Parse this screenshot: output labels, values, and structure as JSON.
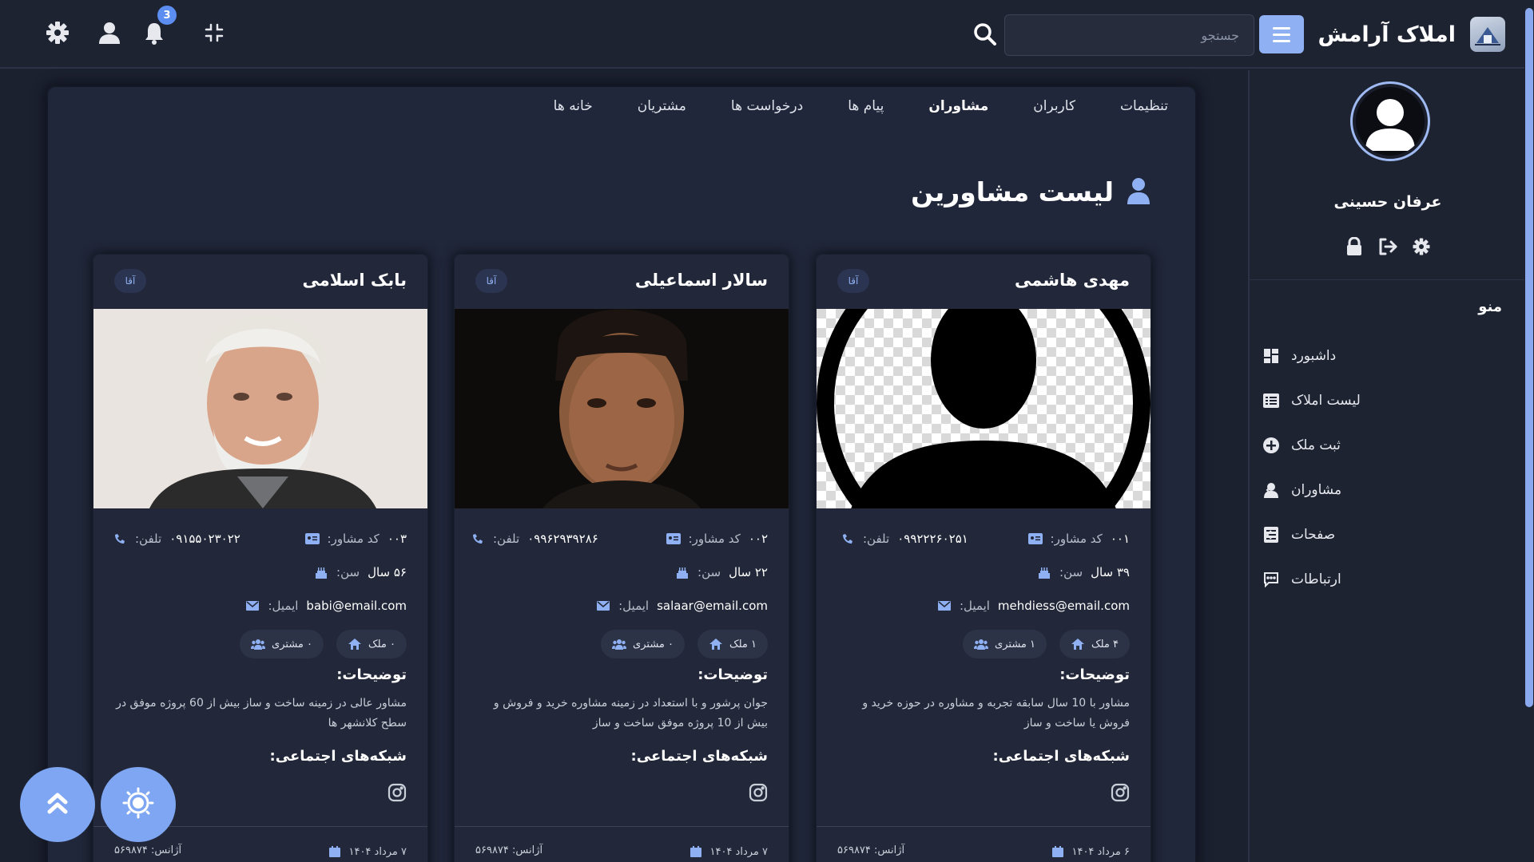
{
  "header": {
    "app_title": "املاک آرامش",
    "search_placeholder": "جستجو",
    "notification_count": "3"
  },
  "sidebar": {
    "user_name": "عرفان حسینی",
    "menu_title": "منو",
    "items": [
      {
        "label": "داشبورد",
        "icon": "dashboard-icon"
      },
      {
        "label": "لیست املاک",
        "icon": "list-icon"
      },
      {
        "label": "ثبت ملک",
        "icon": "plus-circle-icon"
      },
      {
        "label": "مشاوران",
        "icon": "users-icon"
      },
      {
        "label": "صفحات",
        "icon": "pages-icon"
      },
      {
        "label": "ارتباطات",
        "icon": "chat-icon"
      }
    ]
  },
  "tabs": [
    "خانه ها",
    "مشتریان",
    "درخواست ها",
    "پیام ها",
    "مشاوران",
    "کاربران",
    "تنظیمات"
  ],
  "active_tab": "مشاوران",
  "page_title": "لیست مشاورین",
  "labels": {
    "code": "کد مشاور:",
    "phone": "تلفن:",
    "age": "سن:",
    "email": "ایمیل:",
    "description": "توضیحات:",
    "social": "شبکه‌های اجتماعی:"
  },
  "advisors": [
    {
      "name": "مهدی هاشمی",
      "badge": "آقا",
      "code": "۰۰۱",
      "phone": "۰۹۹۲۲۲۶۰۲۵۱",
      "age": "۳۹ سال",
      "email": "mehdiess@email.com",
      "properties": "۴ ملک",
      "customers": "۱ مشتری",
      "description": "مشاور با 10 سال سابقه تجربه و مشاوره در حوزه خرید و فروش یا ساخت و ساز",
      "date": "۶ مرداد ۱۴۰۴",
      "agency": "آژانس: ۵۶۹۸۷۴"
    },
    {
      "name": "سالار اسماعیلی",
      "badge": "آقا",
      "code": "۰۰۲",
      "phone": "۰۹۹۶۲۹۳۹۲۸۶",
      "age": "۲۲ سال",
      "email": "salaar@email.com",
      "properties": "۱ ملک",
      "customers": "۰ مشتری",
      "description": "جوان پرشور و با استعداد در زمینه مشاوره خرید و فروش و بیش از 10 پروژه موفق ساخت و ساز",
      "date": "۷ مرداد ۱۴۰۴",
      "agency": "آژانس: ۵۶۹۸۷۴"
    },
    {
      "name": "بابک اسلامی",
      "badge": "آقا",
      "code": "۰۰۳",
      "phone": "۰۹۱۵۵۰۲۳۰۲۲",
      "age": "۵۶ سال",
      "email": "babi@email.com",
      "properties": "۰ ملک",
      "customers": "۰ مشتری",
      "description": "مشاور عالی در زمینه ساخت و ساز بیش از 60 پروژه موفق در سطح کلانشهر ها",
      "date": "۷ مرداد ۱۴۰۴",
      "agency": "آژانس: ۵۶۹۸۷۴"
    }
  ],
  "colors": {
    "accent": "#8fb0f2",
    "background": "#1c2130",
    "panel": "#21273a"
  }
}
